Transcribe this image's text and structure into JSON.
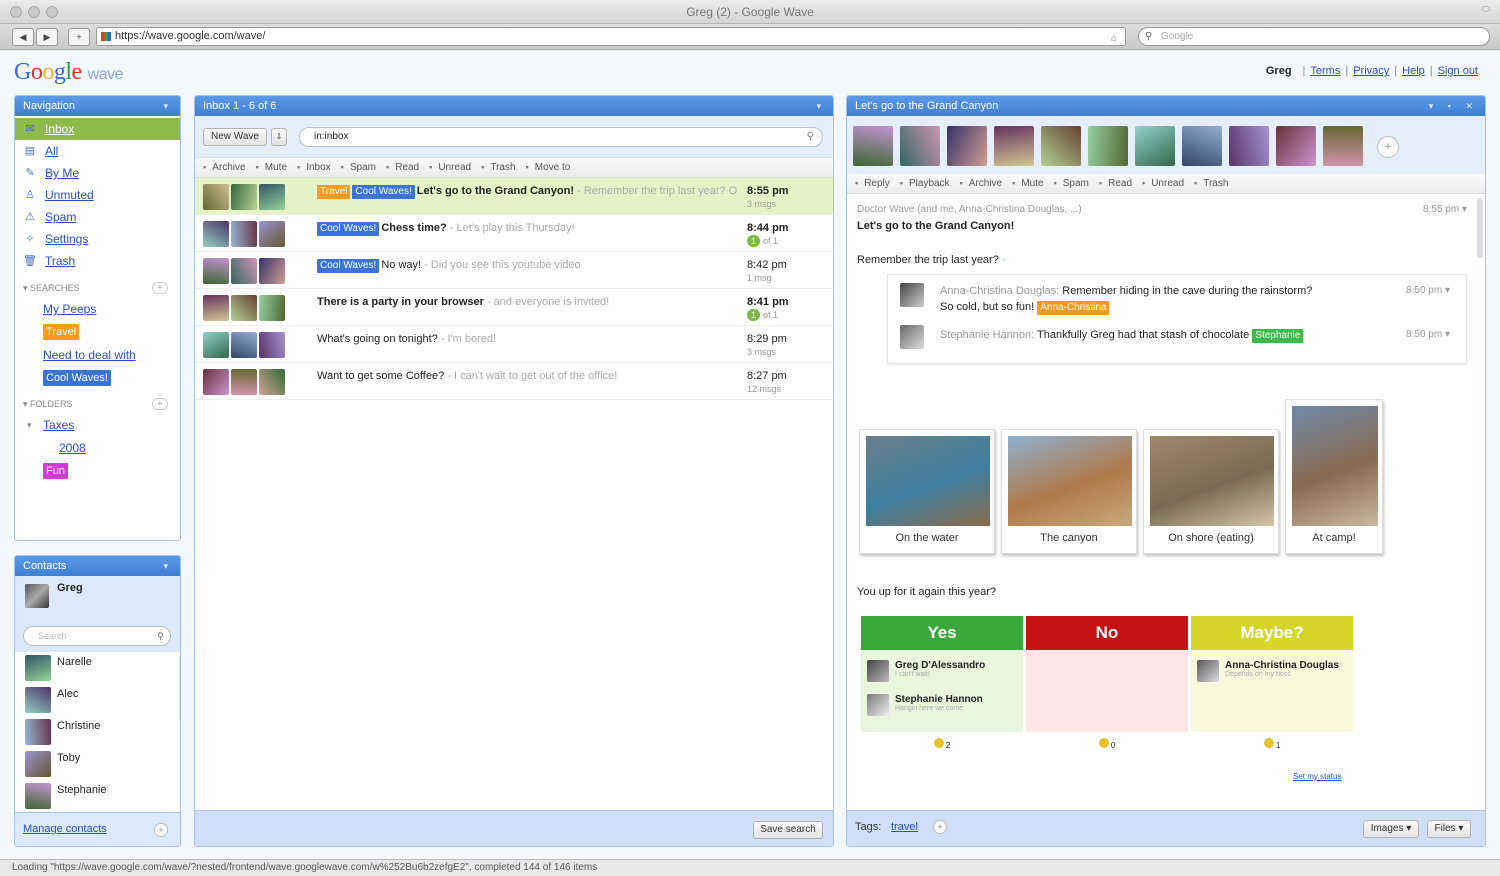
{
  "window": {
    "title": "Greg (2) - Google Wave"
  },
  "browser": {
    "url": "https://wave.google.com/wave/",
    "search_placeholder": "Google"
  },
  "header": {
    "logo_text": "Google",
    "logo_sub": "wave",
    "user": "Greg",
    "links": [
      "Terms",
      "Privacy",
      "Help",
      "Sign out"
    ]
  },
  "navigation": {
    "title": "Navigation",
    "items": [
      {
        "label": "Inbox",
        "icon": "inbox-icon",
        "selected": true
      },
      {
        "label": "All",
        "icon": "all-icon"
      },
      {
        "label": "By Me",
        "icon": "pencil-icon"
      },
      {
        "label": "Unmuted",
        "icon": "person-icon"
      },
      {
        "label": "Spam",
        "icon": "spam-icon"
      },
      {
        "label": "Settings",
        "icon": "wrench-icon"
      },
      {
        "label": "Trash",
        "icon": "trash-icon"
      }
    ],
    "searches_title": "SEARCHES",
    "searches": [
      {
        "label": "My Peeps",
        "kind": "link"
      },
      {
        "label": "Travel",
        "kind": "tag",
        "color": "#f79a1e"
      },
      {
        "label": "Need to deal with",
        "kind": "link"
      },
      {
        "label": "Cool Waves!",
        "kind": "tag",
        "color": "#3a74d6"
      }
    ],
    "folders_title": "FOLDERS",
    "folders": [
      {
        "label": "Taxes",
        "kind": "link"
      },
      {
        "label": "2008",
        "kind": "link"
      },
      {
        "label": "Fun",
        "kind": "tag",
        "color": "#d63ad6"
      }
    ]
  },
  "contacts": {
    "title": "Contacts",
    "me": "Greg",
    "search_placeholder": "Search",
    "list": [
      "Narelle",
      "Alec",
      "Christine",
      "Toby",
      "Stephanie"
    ],
    "manage_label": "Manage contacts"
  },
  "inbox": {
    "title": "Inbox 1 - 6 of 6",
    "new_wave_label": "New Wave",
    "search_value": "in:inbox",
    "toolbar": [
      "Archive",
      "Mute",
      "Inbox",
      "Spam",
      "Read",
      "Unread",
      "Trash",
      "Move to"
    ],
    "save_search_label": "Save search",
    "rows": [
      {
        "tags": [
          {
            "label": "Travel",
            "color": "#f79a1e"
          },
          {
            "label": "Cool Waves!",
            "color": "#3a74d6"
          }
        ],
        "title": "Let's go to the Grand Canyon!",
        "snippet": " - Remember the trip last year? On the water The canyon On shore (eating) At ca",
        "time": "8:55 pm",
        "sub": "3 msgs",
        "highlight": true,
        "bold": true
      },
      {
        "tags": [
          {
            "label": "Cool Waves!",
            "color": "#3a74d6"
          }
        ],
        "title": "Chess time?",
        "snippet": " - Let's play this Thursday!",
        "time": "8:44 pm",
        "sub": "of 1",
        "highlight": false,
        "bold": true,
        "badge": "1"
      },
      {
        "tags": [
          {
            "label": "Cool Waves!",
            "color": "#3a74d6"
          }
        ],
        "title": "No way!",
        "snippet": " - Did you see this youtube video",
        "time": "8:42 pm",
        "sub": "1 msg",
        "highlight": false,
        "bold": false
      },
      {
        "tags": [],
        "title": "There is a party in your browser",
        "snippet": " - and everyone is invited!",
        "time": "8:41 pm",
        "sub": "of 1",
        "highlight": false,
        "bold": true,
        "badge": "1"
      },
      {
        "tags": [],
        "title": "What's going on tonight?",
        "snippet": " - I'm bored!",
        "time": "8:29 pm",
        "sub": "3 msgs",
        "highlight": false,
        "bold": false
      },
      {
        "tags": [],
        "title": "Want to get some Coffee?",
        "snippet": " - I can't wait to get out of the office!",
        "time": "8:27 pm",
        "sub": "12 msgs",
        "highlight": false,
        "bold": false
      }
    ]
  },
  "wave": {
    "title": "Let's go to the Grand Canyon",
    "toolbar": [
      "Reply",
      "Playback",
      "Archive",
      "Mute",
      "Spam",
      "Read",
      "Unread",
      "Trash"
    ],
    "participants_line": "Doctor Wave (and me, Anna-Christina Douglas, ...)",
    "root_time": "8:55 pm",
    "root_title": "Let's go to the Grand Canyon!",
    "root_text": "Remember the trip last year?",
    "replies": [
      {
        "author": "Anna-Christina Douglas:",
        "text": "Remember hiding in the cave during the rainstorm?",
        "time": "8:50 pm",
        "line2": "So cold, but so fun!",
        "tag": "Anna-Christina",
        "tag_color": "#f79a1e"
      },
      {
        "author": "Stephanie Hannon:",
        "text": "Thankfully Greg had that stash of chocolate",
        "time": "8:50 pm",
        "tag": "Stephanie",
        "tag_color": "#3bb94a"
      }
    ],
    "photos": [
      {
        "caption": "On the water"
      },
      {
        "caption": "The canyon"
      },
      {
        "caption": "On shore (eating)"
      },
      {
        "caption": "At camp!"
      }
    ],
    "question": "You up for it again this year?",
    "vote": {
      "yes": {
        "label": "Yes",
        "color": "#3aa83a",
        "count": "2",
        "voters": [
          {
            "name": "Greg D'Alessandro",
            "note": "I can't wait!"
          },
          {
            "name": "Stephanie Hannon",
            "note": "Hangin here we come"
          }
        ]
      },
      "no": {
        "label": "No",
        "color": "#c41212",
        "count": "0",
        "voters": []
      },
      "maybe": {
        "label": "Maybe?",
        "color": "#d6d62a",
        "count": "1",
        "voters": [
          {
            "name": "Anna-Christina Douglas",
            "note": "Depends on my boss"
          }
        ]
      }
    },
    "set_status_label": "Set my status",
    "tags_label": "Tags:",
    "tag_value": "travel",
    "images_label": "Images",
    "files_label": "Files"
  },
  "status_bar": "Loading \"https://wave.google.com/wave/?nested/frontend/wave.googlewave.com/w%252Bu6b2zefgE2\", completed 144 of 146 items"
}
